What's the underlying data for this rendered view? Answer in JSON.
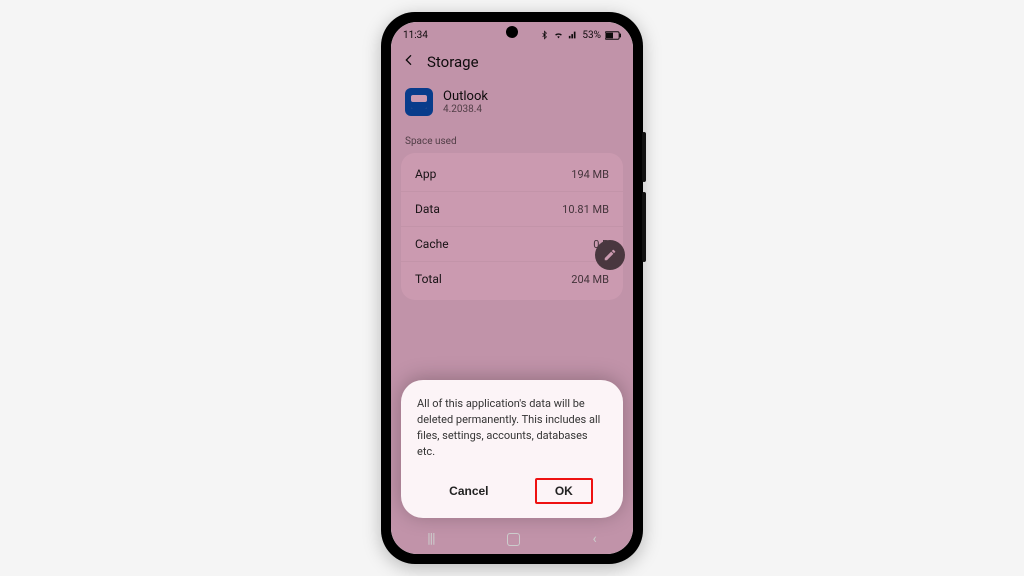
{
  "status": {
    "time": "11:34",
    "battery": "53%"
  },
  "appbar": {
    "title": "Storage"
  },
  "app": {
    "name": "Outlook",
    "version": "4.2038.4"
  },
  "section": {
    "space_used": "Space used"
  },
  "rows": {
    "app": {
      "label": "App",
      "value": "194 MB"
    },
    "data": {
      "label": "Data",
      "value": "10.81 MB"
    },
    "cache": {
      "label": "Cache",
      "value": "0 B"
    },
    "total": {
      "label": "Total",
      "value": "204 MB"
    }
  },
  "dialog": {
    "message": "All of this application's data will be deleted permanently. This includes all files, settings, accounts, databases etc.",
    "cancel": "Cancel",
    "ok": "OK"
  }
}
